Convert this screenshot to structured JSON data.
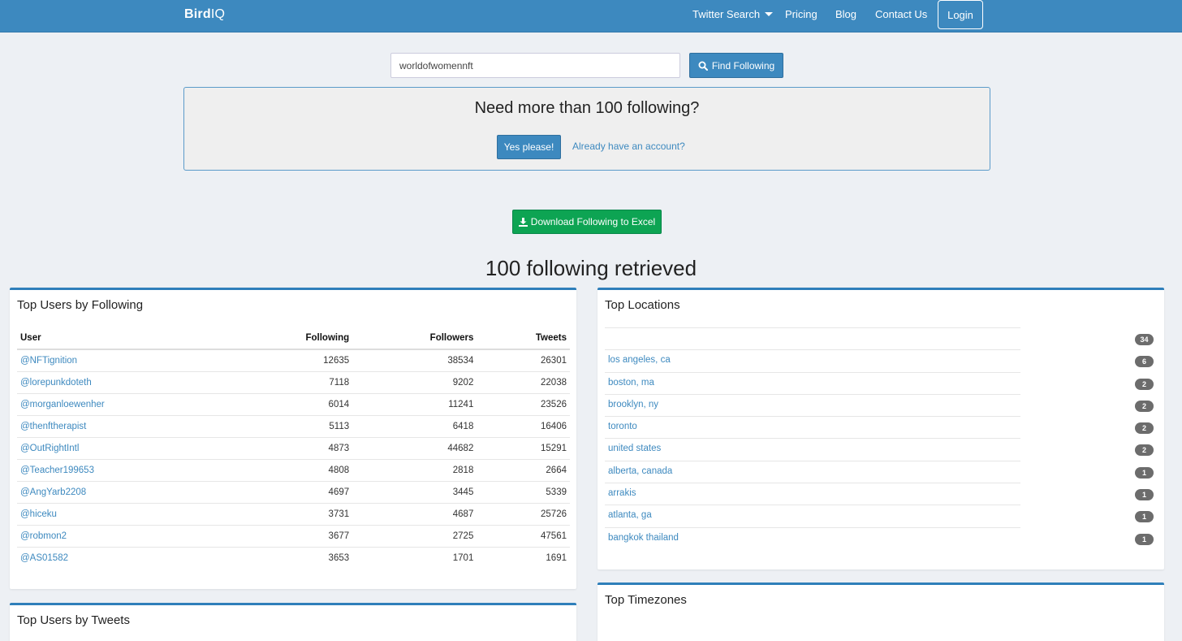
{
  "navbar": {
    "brand_bold": "Bird",
    "brand_rest": "IQ",
    "links": [
      "Twitter Search",
      "Pricing",
      "Blog",
      "Contact Us"
    ],
    "login": "Login"
  },
  "search": {
    "value": "worldofwomennft",
    "button": "Find Following"
  },
  "promo": {
    "title": "Need more than 100 following?",
    "yes": "Yes please!",
    "account": "Already have an account?"
  },
  "download": "Download Following to Excel",
  "retrieved": "100 following retrieved",
  "top_following": {
    "title": "Top Users by Following",
    "headers": [
      "User",
      "Following",
      "Followers",
      "Tweets"
    ],
    "rows": [
      [
        "@NFTignition",
        "12635",
        "38534",
        "26301"
      ],
      [
        "@lorepunkdoteth",
        "7118",
        "9202",
        "22038"
      ],
      [
        "@morganloewenher",
        "6014",
        "11241",
        "23526"
      ],
      [
        "@thenftherapist",
        "5113",
        "6418",
        "16406"
      ],
      [
        "@OutRightIntl",
        "4873",
        "44682",
        "15291"
      ],
      [
        "@Teacher199653",
        "4808",
        "2818",
        "2664"
      ],
      [
        "@AngYarb2208",
        "4697",
        "3445",
        "5339"
      ],
      [
        "@hiceku",
        "3731",
        "4687",
        "25726"
      ],
      [
        "@robmon2",
        "3677",
        "2725",
        "47561"
      ],
      [
        "@AS01582",
        "3653",
        "1701",
        "1691"
      ]
    ]
  },
  "top_locations": {
    "title": "Top Locations",
    "rows": [
      [
        "",
        "34"
      ],
      [
        "los angeles, ca",
        "6"
      ],
      [
        "boston, ma",
        "2"
      ],
      [
        "brooklyn, ny",
        "2"
      ],
      [
        "toronto",
        "2"
      ],
      [
        "united states",
        "2"
      ],
      [
        "alberta, canada",
        "1"
      ],
      [
        "arrakis",
        "1"
      ],
      [
        "atlanta, ga",
        "1"
      ],
      [
        "bangkok thailand",
        "1"
      ]
    ]
  },
  "top_tweets": {
    "title": "Top Users by Tweets"
  },
  "top_timezones": {
    "title": "Top Timezones"
  },
  "colors": {
    "primary": "#3d89bf",
    "success": "#0da453",
    "badge": "#6c6c6c"
  },
  "icons": {
    "find": "search-icon",
    "download": "download-icon",
    "dropdown": "caret-down-icon"
  }
}
